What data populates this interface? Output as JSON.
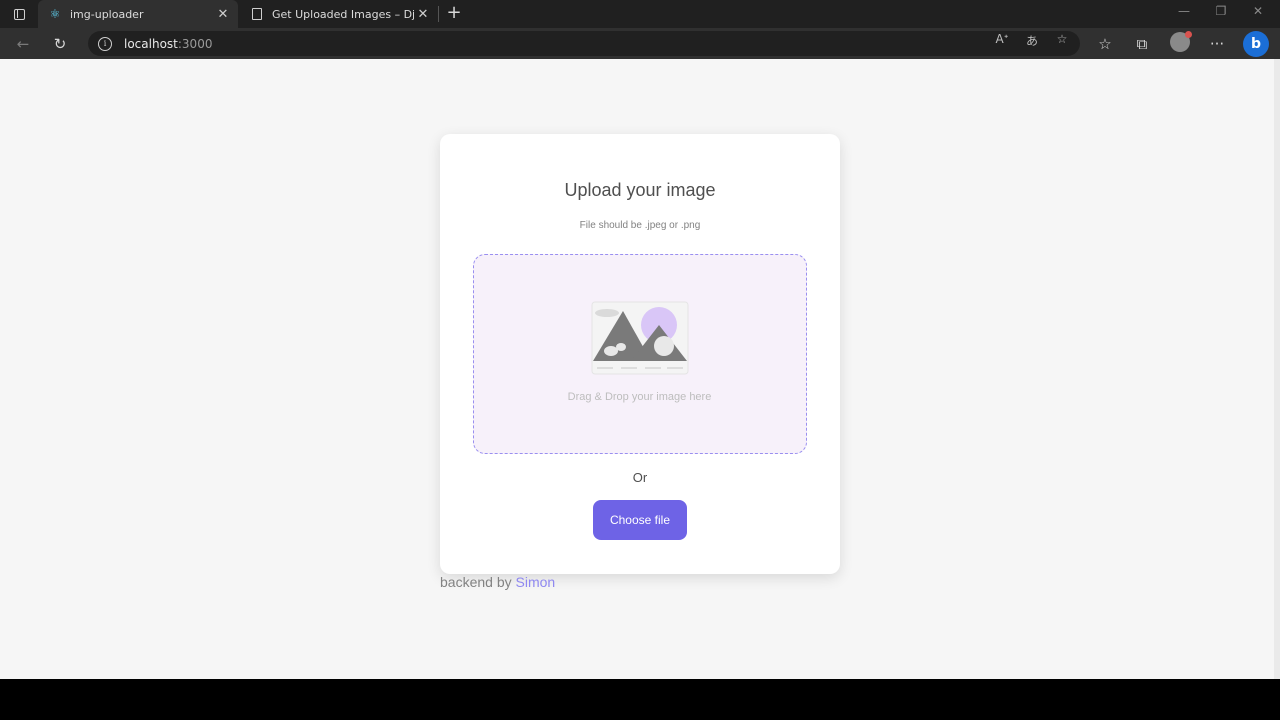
{
  "browser": {
    "tabs": [
      {
        "label": "img-uploader",
        "active": true,
        "icon": "react-icon"
      },
      {
        "label": "Get Uploaded Images – Django",
        "active": false,
        "icon": "document-icon"
      }
    ],
    "address": {
      "host": "localhost",
      "port": ":3000"
    }
  },
  "upload_card": {
    "title": "Upload your image",
    "subtitle": "File should be .jpeg or .png",
    "dropzone_text": "Drag & Drop your image here",
    "or_text": "Or",
    "choose_button": "Choose file"
  },
  "footer": {
    "prefix": "backend by ",
    "author": "Simon"
  },
  "colors": {
    "accent": "#6e63e6",
    "dropzone_bg": "#f7f1fa",
    "dropzone_border": "#9a8ff0",
    "page_bg": "#f6f6f6"
  }
}
